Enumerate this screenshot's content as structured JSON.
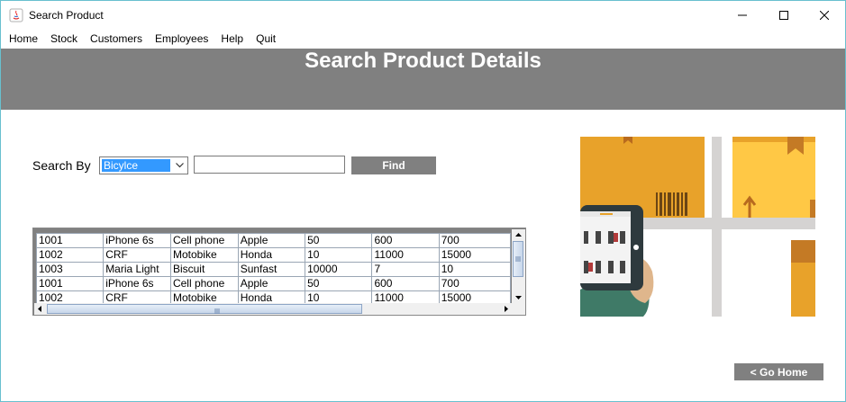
{
  "window": {
    "title": "Search Product",
    "controls": {
      "minimize_icon": "minimize-icon",
      "maximize_icon": "maximize-icon",
      "close_icon": "close-icon"
    }
  },
  "menu": [
    "Home",
    "Stock",
    "Customers",
    "Employees",
    "Help",
    "Quit"
  ],
  "header": {
    "title": "Search Product Details",
    "background": "#808080"
  },
  "search": {
    "label": "Search By",
    "selected_option": "Bicylce",
    "query_value": "",
    "find_label": "Find"
  },
  "table": {
    "rows": [
      [
        "1001",
        "iPhone 6s",
        "Cell phone",
        "Apple",
        "50",
        "600",
        "700"
      ],
      [
        "1002",
        "CRF",
        "Motobike",
        "Honda",
        "10",
        "11000",
        "15000"
      ],
      [
        "1003",
        "Maria Light",
        "Biscuit",
        "Sunfast",
        "10000",
        "7",
        "10"
      ],
      [
        "1001",
        "iPhone 6s",
        "Cell phone",
        "Apple",
        "50",
        "600",
        "700"
      ],
      [
        "1002",
        "CRF",
        "Motobike",
        "Honda",
        "10",
        "11000",
        "15000"
      ]
    ]
  },
  "footer": {
    "go_home_label": "< Go Home"
  },
  "colors": {
    "accent_gray": "#808080",
    "selection_blue": "#3399ff",
    "box_orange": "#e8a22a",
    "box_yellow": "#ffc845",
    "tablet_dark": "#2e3a3e",
    "sleeve_green": "#3f7a67"
  }
}
